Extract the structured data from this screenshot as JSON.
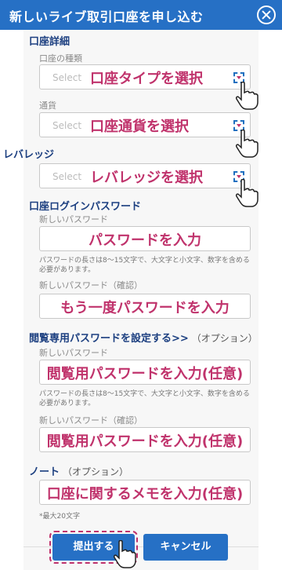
{
  "window": {
    "title": "新しいライブ取引口座を申し込む"
  },
  "sections": {
    "details": "口座詳細",
    "leverage": "レバレッジ",
    "login_pw": "口座ログインパスワード",
    "readonly_pw": "閲覧専用パスワードを設定する>>",
    "readonly_opt": "（オプション）",
    "note": "ノート",
    "note_opt": "（オプション）"
  },
  "fields": {
    "type": {
      "label": "口座の種類",
      "placeholder": "Select",
      "hint": "口座タイプを選択"
    },
    "currency": {
      "label": "通貨",
      "placeholder": "Select",
      "hint": "口座通貨を選択"
    },
    "leverage": {
      "placeholder": "Select",
      "hint": "レバレッジを選択"
    },
    "new_pw": {
      "label": "新しいパスワード",
      "hint": "パスワードを入力"
    },
    "pw_rule": "パスワードの長さは8～15文字で、大文字と小文字、数字を含める必要があります。",
    "confirm_pw": {
      "label": "新しいパスワード（確認）",
      "hint": "もう一度パスワードを入力"
    },
    "ro_pw": {
      "label": "新しいパスワード",
      "hint": "閲覧用パスワードを入力(任意)"
    },
    "ro_pw_rule": "パスワードの長さは8～15文字で、大文字と小文字、数字を含める必要があります。",
    "ro_confirm": {
      "label": "新しいパスワード（確認）",
      "hint": "閲覧用パスワードを入力(任意)"
    },
    "note": {
      "hint": "口座に関するメモを入力(任意)",
      "limit": "*最大20文字"
    }
  },
  "buttons": {
    "submit": "提出する",
    "cancel": "キャンセル"
  },
  "colors": {
    "titlebar": "#2670c5",
    "section": "#1c3f80",
    "annotation": "#c0336c"
  }
}
